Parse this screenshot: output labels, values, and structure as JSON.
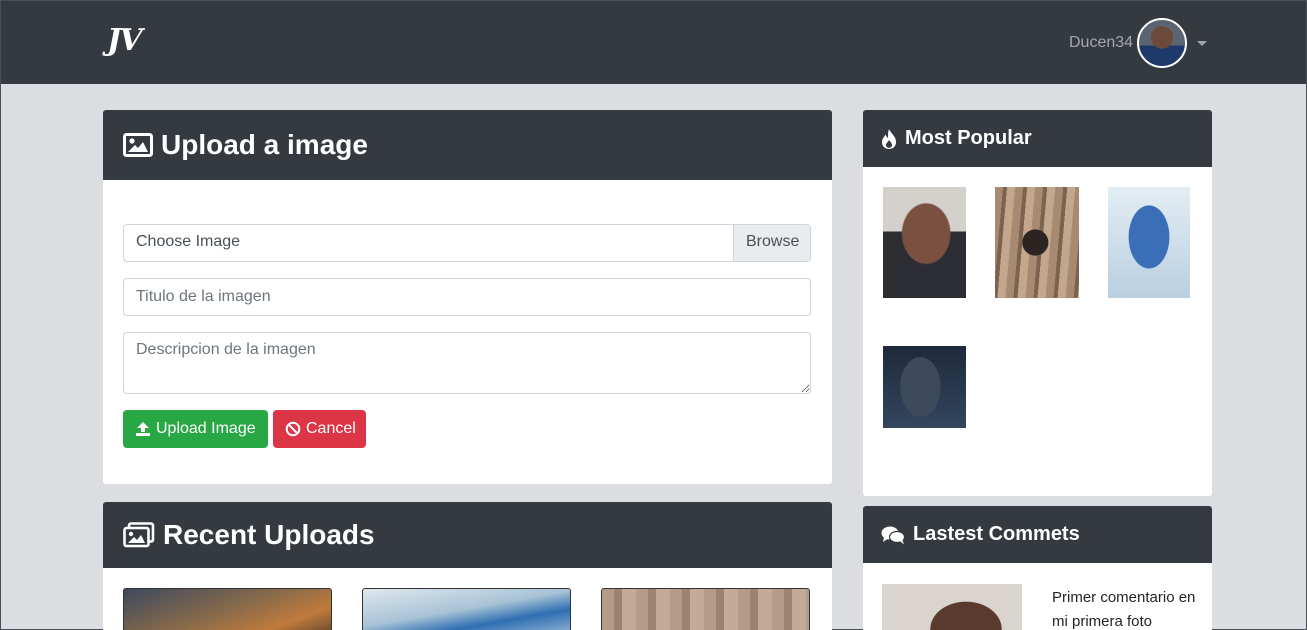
{
  "navbar": {
    "brand": "JV",
    "username": "Ducen34"
  },
  "upload": {
    "title": "Upload a image",
    "file_label": "Choose Image",
    "browse_label": "Browse",
    "title_placeholder": "Titulo de la imagen",
    "description_placeholder": "Descripcion de la imagen",
    "upload_button": "Upload Image",
    "cancel_button": "Cancel"
  },
  "recent": {
    "title": "Recent Uploads"
  },
  "popular": {
    "title": "Most Popular"
  },
  "comments": {
    "title": "Lastest Commets",
    "items": [
      {
        "text": "Primer comentario en mi primera foto"
      }
    ]
  },
  "colors": {
    "navbar": "#343a40",
    "success": "#28a745",
    "danger": "#dc3545",
    "background": "#dcdde0"
  }
}
